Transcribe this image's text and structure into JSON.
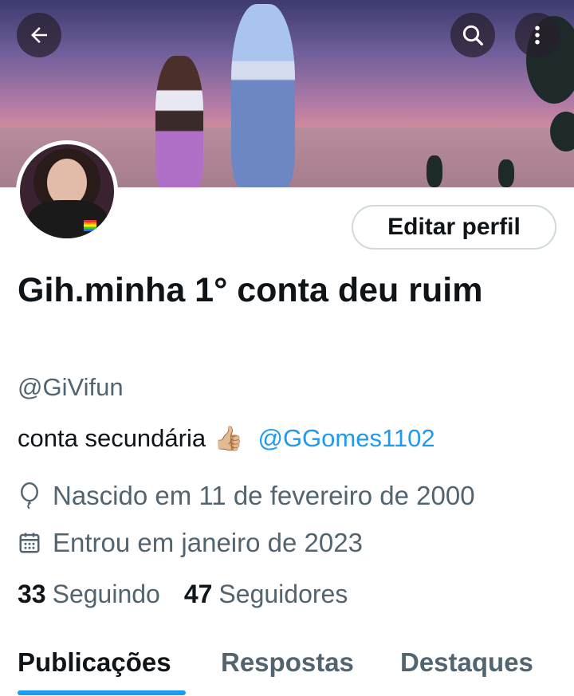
{
  "header": {
    "back_icon": "arrow-left-icon",
    "search_icon": "search-icon",
    "more_icon": "more-vertical-icon"
  },
  "profile": {
    "edit_button": "Editar perfil",
    "display_name": "Gih.minha 1° conta deu ruim",
    "handle": "@GiVifun",
    "bio_text": "conta secundária",
    "bio_emoji": "👍🏼",
    "bio_mention": "@GGomes1102",
    "birthday": "Nascido em 11 de fevereiro de 2000",
    "joined": "Entrou em janeiro de 2023"
  },
  "stats": {
    "following_count": "33",
    "following_label": "Seguindo",
    "followers_count": "47",
    "followers_label": "Seguidores"
  },
  "tabs": [
    {
      "label": "Publicações",
      "active": true
    },
    {
      "label": "Respostas",
      "active": false
    },
    {
      "label": "Destaques",
      "active": false
    }
  ],
  "colors": {
    "accent": "#1d9bf0",
    "text_primary": "#0f1419",
    "text_secondary": "#536471"
  }
}
